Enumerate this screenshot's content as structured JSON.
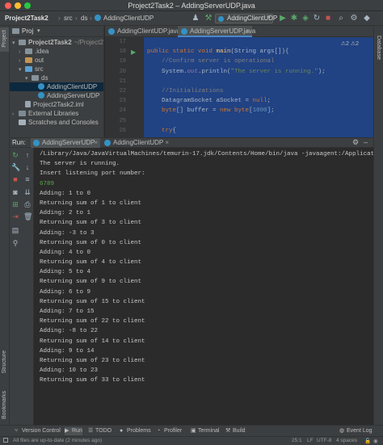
{
  "window": {
    "title": "Project2Task2 – AddingServerUDP.java",
    "traffic_colors": [
      "#ff5f57",
      "#febc2e",
      "#28c840"
    ]
  },
  "navbar": {
    "crumbs": [
      "Project2Task2",
      "src",
      "ds",
      "AddingClientUDP"
    ],
    "run_config": "AddingClientUDP"
  },
  "left_stripe": {
    "project_label": "Project",
    "structure_label": "Structure",
    "bookmarks_label": "Bookmarks"
  },
  "right_stripe": {
    "database_label": "Database"
  },
  "project_panel": {
    "header": "Proj",
    "tree": [
      {
        "label": "Project2Task2",
        "suffix": "~/Project2T",
        "indent": 0,
        "arrow": "▾",
        "icon": "folder"
      },
      {
        "label": ".idea",
        "suffix": "",
        "indent": 1,
        "arrow": "›",
        "icon": "folder"
      },
      {
        "label": "out",
        "suffix": "",
        "indent": 1,
        "arrow": "›",
        "icon": "folder-orange"
      },
      {
        "label": "src",
        "suffix": "",
        "indent": 1,
        "arrow": "▾",
        "icon": "folder-blue"
      },
      {
        "label": "ds",
        "suffix": "",
        "indent": 2,
        "arrow": "▾",
        "icon": "folder"
      },
      {
        "label": "AddingClientUDP",
        "suffix": "",
        "indent": 3,
        "arrow": "",
        "icon": "class"
      },
      {
        "label": "AddingServerUDP",
        "suffix": "",
        "indent": 3,
        "arrow": "",
        "icon": "class"
      },
      {
        "label": "Project2Task2.iml",
        "suffix": "",
        "indent": 1,
        "arrow": "",
        "icon": "file"
      },
      {
        "label": "External Libraries",
        "suffix": "",
        "indent": 0,
        "arrow": "›",
        "icon": "lib"
      },
      {
        "label": "Scratches and Consoles",
        "suffix": "",
        "indent": 0,
        "arrow": "",
        "icon": "scratch"
      }
    ]
  },
  "editor": {
    "tabs": [
      {
        "label": "AddingClientUDP.java",
        "active": false
      },
      {
        "label": "AddingServerUDP.java",
        "active": true
      }
    ],
    "inspection": "⚠2  ⚠2",
    "line_numbers": [
      "17",
      "18",
      "19",
      "20",
      "21",
      "22",
      "23",
      "24",
      "25",
      "26"
    ],
    "lines": [
      {
        "parts": [
          {
            "t": "",
            "c": ""
          }
        ]
      },
      {
        "parts": [
          {
            "t": "public static void ",
            "c": "kw"
          },
          {
            "t": "main",
            "c": "fn"
          },
          {
            "t": "(String args[]){",
            "c": ""
          }
        ]
      },
      {
        "parts": [
          {
            "t": "    //Confirm server is operational",
            "c": "cm"
          }
        ]
      },
      {
        "parts": [
          {
            "t": "    System.",
            "c": ""
          },
          {
            "t": "out",
            "c": "fl"
          },
          {
            "t": ".println(",
            "c": ""
          },
          {
            "t": "\"The server is running.\"",
            "c": "st"
          },
          {
            "t": ");",
            "c": ""
          }
        ]
      },
      {
        "parts": [
          {
            "t": "",
            "c": ""
          }
        ]
      },
      {
        "parts": [
          {
            "t": "    //Initializations",
            "c": "cm"
          }
        ]
      },
      {
        "parts": [
          {
            "t": "    DatagramSocket aSocket = ",
            "c": ""
          },
          {
            "t": "null",
            "c": "kw"
          },
          {
            "t": ";",
            "c": ""
          }
        ]
      },
      {
        "parts": [
          {
            "t": "    ",
            "c": ""
          },
          {
            "t": "byte",
            "c": "kw"
          },
          {
            "t": "[] buffer = ",
            "c": ""
          },
          {
            "t": "new byte",
            "c": "kw"
          },
          {
            "t": "[",
            "c": ""
          },
          {
            "t": "1000",
            "c": "nm"
          },
          {
            "t": "];",
            "c": ""
          }
        ]
      },
      {
        "parts": [
          {
            "t": "",
            "c": ""
          }
        ]
      },
      {
        "parts": [
          {
            "t": "    ",
            "c": ""
          },
          {
            "t": "try",
            "c": "kw"
          },
          {
            "t": "{",
            "c": ""
          }
        ]
      }
    ]
  },
  "run_panel": {
    "label": "Run:",
    "tabs": [
      {
        "label": "AddingServerUDP",
        "active": true
      },
      {
        "label": "AddingClientUDP",
        "active": false
      }
    ],
    "console": [
      {
        "text": "/Library/Java/JavaVirtualMachines/temurin-17.jdk/Contents/Home/bin/java -javaagent:/Applications/",
        "kind": "cmdline"
      },
      {
        "text": "The server is running.",
        "kind": "out"
      },
      {
        "text": "Insert listening port number:",
        "kind": "out"
      },
      {
        "text": "6789",
        "kind": "input"
      },
      {
        "text": "Adding: 1 to 0",
        "kind": "out"
      },
      {
        "text": "Returning sum of 1 to client",
        "kind": "out"
      },
      {
        "text": "Adding: 2 to 1",
        "kind": "out"
      },
      {
        "text": "Returning sum of 3 to client",
        "kind": "out"
      },
      {
        "text": "Adding: -3 to 3",
        "kind": "out"
      },
      {
        "text": "Returning sum of 0 to client",
        "kind": "out"
      },
      {
        "text": "Adding: 4 to 0",
        "kind": "out"
      },
      {
        "text": "Returning sum of 4 to client",
        "kind": "out"
      },
      {
        "text": "Adding: 5 to 4",
        "kind": "out"
      },
      {
        "text": "Returning sum of 9 to client",
        "kind": "out"
      },
      {
        "text": "Adding: 6 to 9",
        "kind": "out"
      },
      {
        "text": "Returning sum of 15 to client",
        "kind": "out"
      },
      {
        "text": "Adding: 7 to 15",
        "kind": "out"
      },
      {
        "text": "Returning sum of 22 to client",
        "kind": "out"
      },
      {
        "text": "Adding: -8 to 22",
        "kind": "out"
      },
      {
        "text": "Returning sum of 14 to client",
        "kind": "out"
      },
      {
        "text": "Adding: 9 to 14",
        "kind": "out"
      },
      {
        "text": "Returning sum of 23 to client",
        "kind": "out"
      },
      {
        "text": "Adding: 10 to 23",
        "kind": "out"
      },
      {
        "text": "Returning sum of 33 to client",
        "kind": "out"
      }
    ]
  },
  "bottom_tools": [
    {
      "label": "Version Control",
      "icon": "branch-icon",
      "glyph": "⑂"
    },
    {
      "label": "Run",
      "icon": "run-icon",
      "glyph": "▶"
    },
    {
      "label": "TODO",
      "icon": "todo-icon",
      "glyph": "☰"
    },
    {
      "label": "Problems",
      "icon": "problems-icon",
      "glyph": "●"
    },
    {
      "label": "Profiler",
      "icon": "profiler-icon",
      "glyph": "◔"
    },
    {
      "label": "Terminal",
      "icon": "terminal-icon",
      "glyph": "▣"
    },
    {
      "label": "Build",
      "icon": "build-icon",
      "glyph": "⚒"
    }
  ],
  "event_log": "Event Log",
  "statusbar": {
    "message": "All files are up-to-date (2 minutes ago)",
    "position": "25:1",
    "line_sep": "LF",
    "encoding": "UTF-8",
    "indent": "4 spaces"
  }
}
